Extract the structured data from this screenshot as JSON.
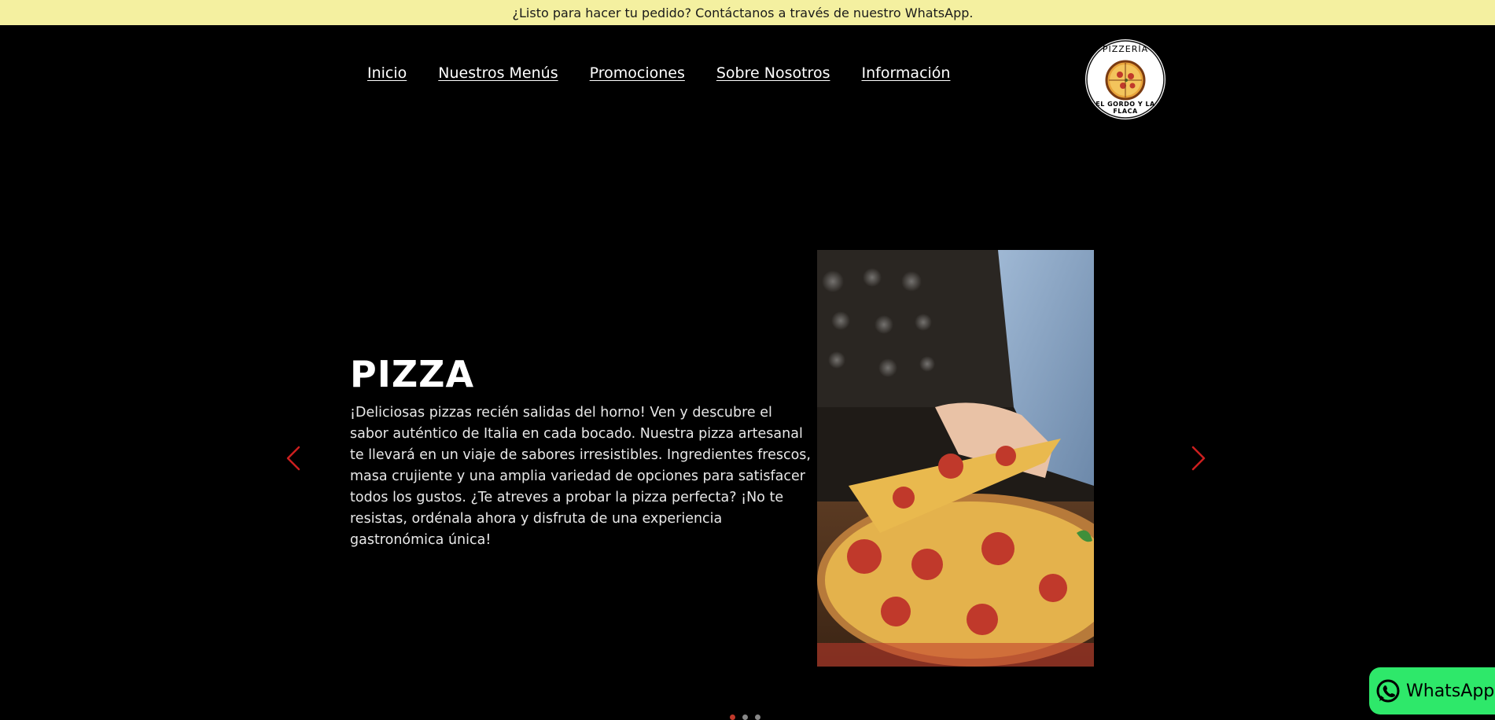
{
  "banner": {
    "text": "¿Listo para hacer tu pedido? Contáctanos a través de nuestro WhatsApp."
  },
  "nav": {
    "items": [
      {
        "label": "Inicio"
      },
      {
        "label": "Nuestros Menús"
      },
      {
        "label": "Promociones"
      },
      {
        "label": "Sobre Nosotros"
      },
      {
        "label": "Información"
      }
    ]
  },
  "logo": {
    "top_text": "PIZZERÍA",
    "bottom_text": "EL GORDO Y LA FLACA"
  },
  "hero": {
    "title": "PIZZA",
    "description": "¡Deliciosas pizzas recién salidas del horno! Ven y descubre el sabor auténtico de Italia en cada bocado. Nuestra pizza artesanal te llevará en un viaje de sabores irresistibles. Ingredientes frescos, masa crujiente y una amplia variedad de opciones para satisfacer todos los gustos. ¿Te atreves a probar la pizza perfecta? ¡No te resistas, ordénala ahora y disfruta de una experiencia gastronómica única!",
    "image_icon": "pizza-slice-photo"
  },
  "carousel": {
    "prev_icon": "chevron-left-icon",
    "next_icon": "chevron-right-icon",
    "slide_count": 3,
    "active_slide": 1,
    "accent_color": "#cc1f1f"
  },
  "whatsapp": {
    "label": "WhatsApp",
    "color": "#2ee86a"
  },
  "colors": {
    "banner_bg": "#f4f0a0",
    "page_bg": "#000000"
  }
}
